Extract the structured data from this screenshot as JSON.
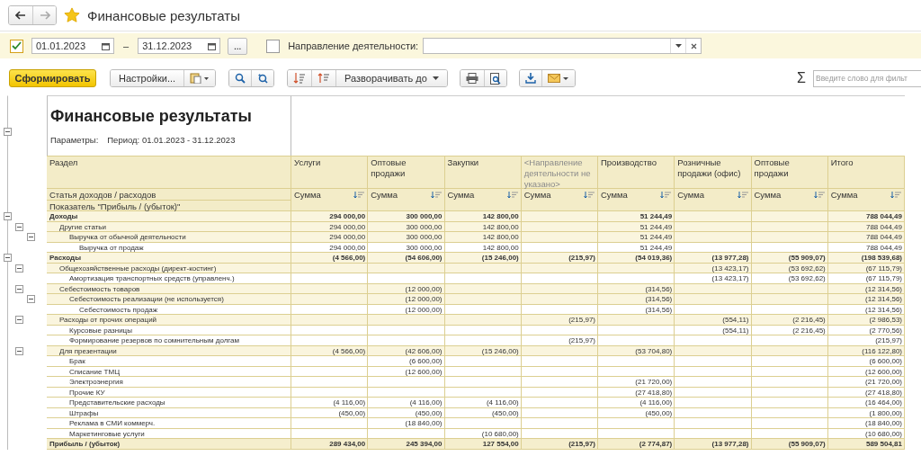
{
  "window": {
    "title": "Финансовые результаты",
    "favorite": true
  },
  "filters": {
    "period_enabled": true,
    "date_from": "01.01.2023",
    "separator": "–",
    "date_to": "31.12.2023",
    "more_button": "...",
    "direction_enabled": false,
    "direction_label": "Направление деятельности:"
  },
  "toolbar": {
    "generate": "Сформировать",
    "settings": "Настройки...",
    "expand_to": "Разворачивать до",
    "sigma": "Σ",
    "search": {
      "placeholder": "Введите слово для фильт"
    }
  },
  "report": {
    "expanded": true,
    "title": "Финансовые результаты",
    "params_label": "Параметры:",
    "params_value": "Период: 01.01.2023 - 31.12.2023"
  },
  "table": {
    "header_1": "Раздел",
    "header_2": "Статья доходов / расходов",
    "header_3": "Показатель \"Прибыль / (убыток)\"",
    "columns": [
      {
        "title": "Услуги",
        "dimmed": false,
        "subheader": "Сумма"
      },
      {
        "title": "Оптовые продажи",
        "dimmed": false,
        "subheader": "Сумма"
      },
      {
        "title": "Закупки",
        "dimmed": false,
        "subheader": "Сумма"
      },
      {
        "title": "<Направление деятельности не указано>",
        "dimmed": true,
        "subheader": "Сумма"
      },
      {
        "title": "Производство",
        "dimmed": false,
        "subheader": "Сумма"
      },
      {
        "title": "Розничные продажи (офис)",
        "dimmed": false,
        "subheader": "Сумма"
      },
      {
        "title": "Оптовые продажи",
        "dimmed": false,
        "subheader": "Сумма"
      },
      {
        "title": "Итого",
        "dimmed": false,
        "subheader": "Сумма"
      }
    ],
    "rows": [
      {
        "label": "Доходы",
        "kind": "section",
        "expanded": true,
        "values": {
          "col_1": "294 000,00",
          "col_2": "300 000,00",
          "col_3": "142 800,00",
          "col_5": "51 244,49",
          "col_8": "788 044,49"
        },
        "children": [
          {
            "label": "Другие статьи",
            "kind": "item",
            "expanded": true,
            "values": {
              "col_1": "294 000,00",
              "col_2": "300 000,00",
              "col_3": "142 800,00",
              "col_5": "51 244,49",
              "col_8": "788 044,49"
            },
            "children": [
              {
                "label": "Выручка от обычной деятельности",
                "kind": "item",
                "expanded": true,
                "values": {
                  "col_1": "294 000,00",
                  "col_2": "300 000,00",
                  "col_3": "142 800,00",
                  "col_5": "51 244,49",
                  "col_8": "788 044,49"
                },
                "children": [
                  {
                    "label": "Выручка от продаж",
                    "kind": "item",
                    "values": {
                      "col_1": "294 000,00",
                      "col_2": "300 000,00",
                      "col_3": "142 800,00",
                      "col_5": "51 244,49",
                      "col_8": "788 044,49"
                    }
                  }
                ]
              }
            ]
          }
        ]
      },
      {
        "label": "Расходы",
        "kind": "section",
        "expanded": true,
        "values": {
          "col_1": "(4 566,00)",
          "col_2": "(54 606,00)",
          "col_3": "(15 246,00)",
          "col_4": "(215,97)",
          "col_5": "(54 019,36)",
          "col_6": "(13 977,28)",
          "col_7": "(55 909,07)",
          "col_8": "(198 539,68)"
        },
        "children": [
          {
            "label": "Общехозяйственные расходы (директ-костинг)",
            "kind": "item",
            "expanded": true,
            "values": {
              "col_6": "(13 423,17)",
              "col_7": "(53 692,62)",
              "col_8": "(67 115,79)"
            },
            "children": [
              {
                "label": "Амортизация транспортных средств (управленч.)",
                "kind": "item",
                "values": {
                  "col_6": "(13 423,17)",
                  "col_7": "(53 692,62)",
                  "col_8": "(67 115,79)"
                }
              }
            ]
          },
          {
            "label": "Себестоимость товаров",
            "kind": "item",
            "expanded": true,
            "values": {
              "col_2": "(12 000,00)",
              "col_5": "(314,56)",
              "col_8": "(12 314,56)"
            },
            "children": [
              {
                "label": "Себестоимость реализации (не используется)",
                "kind": "item",
                "expanded": true,
                "values": {
                  "col_2": "(12 000,00)",
                  "col_5": "(314,56)",
                  "col_8": "(12 314,56)"
                },
                "children": [
                  {
                    "label": "Себестоимость продаж",
                    "kind": "item",
                    "values": {
                      "col_2": "(12 000,00)",
                      "col_5": "(314,56)",
                      "col_8": "(12 314,56)"
                    }
                  }
                ]
              }
            ]
          },
          {
            "label": "Расходы от прочих операций",
            "kind": "item",
            "expanded": true,
            "values": {
              "col_4": "(215,97)",
              "col_6": "(554,11)",
              "col_7": "(2 216,45)",
              "col_8": "(2 986,53)"
            },
            "children": [
              {
                "label": "Курсовые разницы",
                "kind": "item",
                "values": {
                  "col_6": "(554,11)",
                  "col_7": "(2 216,45)",
                  "col_8": "(2 770,56)"
                }
              },
              {
                "label": "Формирование резервов по сомнительным долгам",
                "kind": "item",
                "values": {
                  "col_4": "(215,97)",
                  "col_8": "(215,97)"
                }
              }
            ]
          },
          {
            "label": "Для презентации",
            "kind": "item",
            "expanded": true,
            "values": {
              "col_1": "(4 566,00)",
              "col_2": "(42 606,00)",
              "col_3": "(15 246,00)",
              "col_5": "(53 704,80)",
              "col_8": "(116 122,80)"
            },
            "children": [
              {
                "label": "Брак",
                "kind": "item",
                "values": {
                  "col_2": "(6 600,00)",
                  "col_8": "(6 600,00)"
                }
              },
              {
                "label": "Списание ТМЦ",
                "kind": "item",
                "values": {
                  "col_2": "(12 600,00)",
                  "col_8": "(12 600,00)"
                }
              },
              {
                "label": "Электроэнергия",
                "kind": "item",
                "values": {
                  "col_5": "(21 720,00)",
                  "col_8": "(21 720,00)"
                }
              },
              {
                "label": "Прочие КУ",
                "kind": "item",
                "values": {
                  "col_5": "(27 418,80)",
                  "col_8": "(27 418,80)"
                }
              },
              {
                "label": "Представительские расходы",
                "kind": "item",
                "values": {
                  "col_1": "(4 116,00)",
                  "col_2": "(4 116,00)",
                  "col_3": "(4 116,00)",
                  "col_5": "(4 116,00)",
                  "col_8": "(16 464,00)"
                }
              },
              {
                "label": "Штрафы",
                "kind": "item",
                "values": {
                  "col_1": "(450,00)",
                  "col_2": "(450,00)",
                  "col_3": "(450,00)",
                  "col_5": "(450,00)",
                  "col_8": "(1 800,00)"
                }
              },
              {
                "label": "Реклама в СМИ коммерч.",
                "kind": "item",
                "values": {
                  "col_2": "(18 840,00)",
                  "col_8": "(18 840,00)"
                }
              },
              {
                "label": "Маркетинговые услуги",
                "kind": "item",
                "values": {
                  "col_3": "(10 680,00)",
                  "col_8": "(10 680,00)"
                }
              }
            ]
          }
        ]
      },
      {
        "label": "Прибыль / (убыток)",
        "kind": "total",
        "values": {
          "col_1": "289 434,00",
          "col_2": "245 394,00",
          "col_3": "127 554,00",
          "col_4": "(215,97)",
          "col_5": "(2 774,87)",
          "col_6": "(13 977,28)",
          "col_7": "(55 909,07)",
          "col_8": "589 504,81"
        }
      }
    ]
  }
}
